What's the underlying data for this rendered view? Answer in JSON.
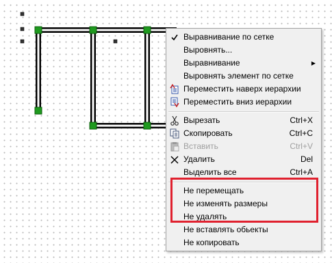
{
  "context_menu": {
    "items": [
      {
        "label": "Выравнивание по сетке",
        "shortcut": "",
        "icon": "checkmark-icon",
        "enabled": true
      },
      {
        "label": "Выровнять...",
        "shortcut": "",
        "icon": "",
        "enabled": true
      },
      {
        "label": "Выравнивание",
        "shortcut": "",
        "icon": "",
        "enabled": true,
        "submenu": true
      },
      {
        "label": "Выровнять элемент по сетке",
        "shortcut": "",
        "icon": "",
        "enabled": true
      },
      {
        "label": "Переместить наверх иерархии",
        "shortcut": "",
        "icon": "bring-to-front-icon",
        "enabled": true
      },
      {
        "label": "Переместить вниз иерархии",
        "shortcut": "",
        "icon": "send-to-back-icon",
        "enabled": true
      },
      {
        "label": "Вырезать",
        "shortcut": "Ctrl+X",
        "icon": "scissors-icon",
        "enabled": true
      },
      {
        "label": "Скопировать",
        "shortcut": "Ctrl+C",
        "icon": "copy-icon",
        "enabled": true
      },
      {
        "label": "Вставить",
        "shortcut": "Ctrl+V",
        "icon": "paste-icon",
        "enabled": false
      },
      {
        "label": "Удалить",
        "shortcut": "Del",
        "icon": "delete-x-icon",
        "enabled": true
      },
      {
        "label": "Выделить все",
        "shortcut": "Ctrl+A",
        "icon": "",
        "enabled": true
      },
      {
        "label": "Не перемещать",
        "shortcut": "",
        "icon": "",
        "enabled": true
      },
      {
        "label": "Не изменять размеры",
        "shortcut": "",
        "icon": "",
        "enabled": true
      },
      {
        "label": "Не удалять",
        "shortcut": "",
        "icon": "",
        "enabled": true
      },
      {
        "label": "Не вставлять обьекты",
        "shortcut": "",
        "icon": "",
        "enabled": true
      },
      {
        "label": "Не копировать",
        "shortcut": "",
        "icon": "",
        "enabled": true
      }
    ]
  },
  "colors": {
    "menu_background": "#f0f0f0",
    "highlight_border": "#e0202e",
    "pipe_node": "#1f9a1f",
    "selection_handle": "#333333"
  }
}
